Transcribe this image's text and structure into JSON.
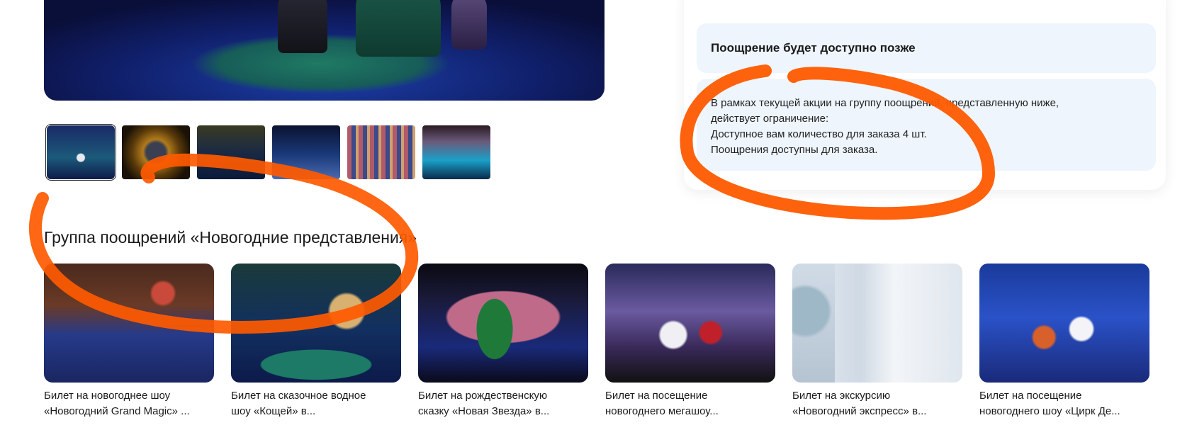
{
  "notice": {
    "title": "Поощрение будет доступно позже"
  },
  "info": {
    "lines": [
      "В рамках текущей акции на группу поощрений, представленную ниже,",
      "действует ограничение:",
      "Доступное вам количество для заказа 4 шт.",
      "Поощрения доступны для заказа."
    ]
  },
  "section": {
    "title": "Группа поощрений «Новогодние представления»"
  },
  "products": [
    {
      "line1": "Билет на новогоднее шоу",
      "line2": "«Новогодний Grand Magic» ..."
    },
    {
      "line1": "Билет на сказочное водное",
      "line2": "шоу «Кощей» в..."
    },
    {
      "line1": "Билет на рождественскую",
      "line2": "сказку «Новая Звезда» в..."
    },
    {
      "line1": "Билет на посещение",
      "line2": "новогоднего мегашоу..."
    },
    {
      "line1": "Билет на экскурсию",
      "line2": "«Новогодний экспресс» в..."
    },
    {
      "line1": "Билет на посещение",
      "line2": "новогоднего шоу «Цирк Де..."
    }
  ],
  "colors": {
    "annotation": "#ff5a00",
    "panel": "#eef5fd"
  }
}
